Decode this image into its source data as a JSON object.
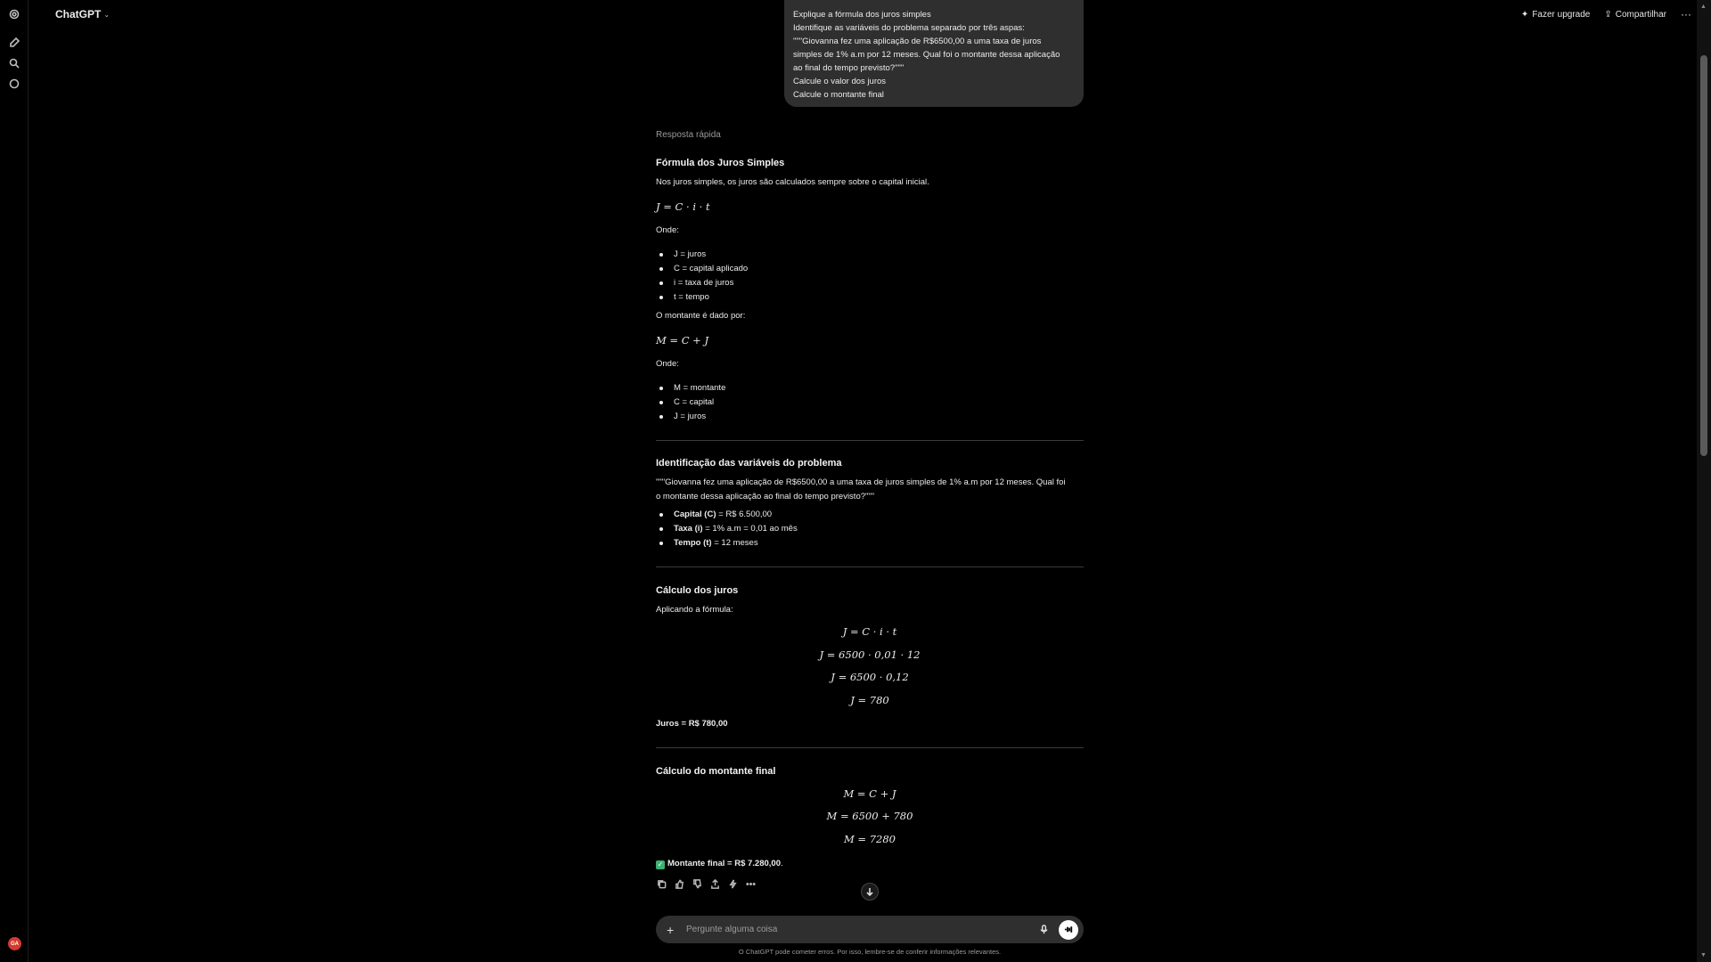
{
  "app": {
    "model_name": "ChatGPT"
  },
  "topbar": {
    "upgrade_label": "Fazer upgrade",
    "share_label": "Compartilhar",
    "more_label": "···"
  },
  "user_message": {
    "lines": [
      "Explique a fórmula dos juros simples",
      "Identifique as variáveis do problema separado por três aspas:",
      "\"\"\"Giovanna fez uma aplicação de R$6500,00 a uma taxa de juros",
      "simples de 1% a.m por 12 meses. Qual foi o montante dessa aplicação",
      "ao final do tempo previsto?\"\"\"",
      "Calcule o valor dos juros",
      "Calcule o montante final"
    ]
  },
  "answer": {
    "mode_label": "Resposta rápida",
    "s1": {
      "title": "Fórmula dos Juros Simples",
      "intro": "Nos juros simples, os juros são calculados sempre sobre o capital inicial.",
      "formula": "J = C · i · t",
      "onde": "Onde:",
      "items": [
        "J = juros",
        "C = capital aplicado",
        "i = taxa de juros",
        "t = tempo"
      ],
      "montante_intro": "O montante é dado por:",
      "formula2": "M = C + J",
      "onde2": "Onde:",
      "items2": [
        "M = montante",
        "C = capital",
        "J = juros"
      ]
    },
    "s2": {
      "title": "Identificação das variáveis do problema",
      "quote_line1": "\"\"\"Giovanna fez uma aplicação de R$6500,00 a uma taxa de juros simples de 1% a.m por 12 meses. Qual foi",
      "quote_line2": "o montante dessa aplicação ao final do tempo previsto?\"\"\"",
      "vars": [
        {
          "label": "Capital (C)",
          "value": " = R$ 6.500,00"
        },
        {
          "label": "Taxa (i)",
          "value": " = 1% a.m = 0,01 ao mês"
        },
        {
          "label": "Tempo (t)",
          "value": " = 12 meses"
        }
      ]
    },
    "s3": {
      "title": "Cálculo dos juros",
      "intro": "Aplicando a fórmula:",
      "steps": [
        "J = C · i · t",
        "J = 6500 · 0,01 · 12",
        "J = 6500 · 0,12",
        "J = 780"
      ],
      "result": "Juros = R$ 780,00"
    },
    "s4": {
      "title": "Cálculo do montante final",
      "steps": [
        "M = C + J",
        "M = 6500 + 780",
        "M = 7280"
      ],
      "result": "Montante final = R$ 7.280,00",
      "result_suffix": "."
    }
  },
  "composer": {
    "placeholder": "Pergunte alguma coisa",
    "disclaimer": "O ChatGPT pode cometer erros. Por isso, lembre-se de conferir informações relevantes."
  },
  "user": {
    "avatar_initials": "GA"
  },
  "colors": {
    "background": "#000000",
    "bubble": "#2f2f2f",
    "check": "#3bb273",
    "avatar": "#d23b2e"
  }
}
